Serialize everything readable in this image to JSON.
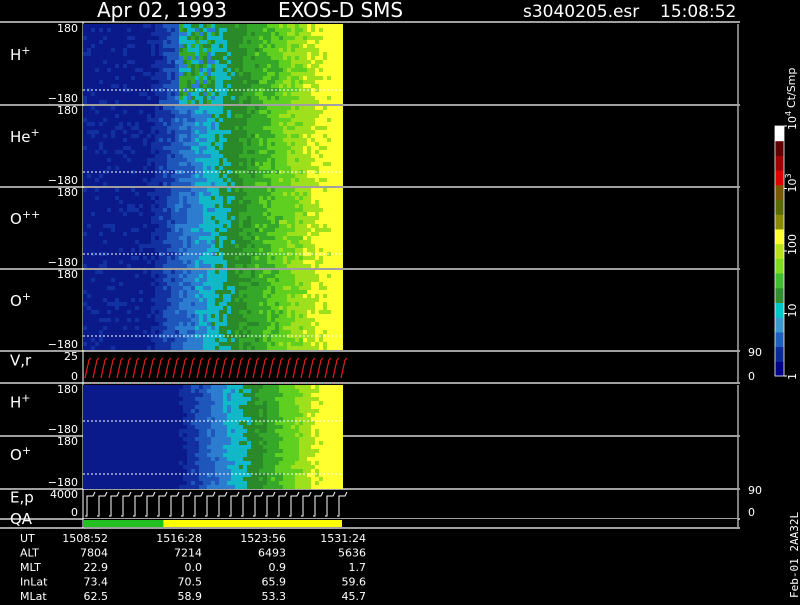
{
  "header": {
    "date": "Apr 02, 1993",
    "instrument": "EXOS-D SMS",
    "file": "s3040205.esr",
    "time": "15:08:52"
  },
  "colorbar": {
    "unit": "Ct/Smp",
    "ticks": [
      {
        "label": "1",
        "value": 1
      },
      {
        "label": "10",
        "value": 10
      },
      {
        "label": "100",
        "value": 100
      },
      {
        "label": "10",
        "sup": "3",
        "value": 1000
      },
      {
        "label": "10",
        "sup": "4",
        "value": 10000
      }
    ],
    "colors": [
      "#00008b",
      "#0a2a9c",
      "#1f5fbf",
      "#3a9ad0",
      "#00c8c8",
      "#2f8f2f",
      "#3fbf2f",
      "#7fdc1f",
      "#b9e21a",
      "#ffff30",
      "#8a8a00",
      "#5a6b00",
      "#7a5a00",
      "#e00000",
      "#a00000",
      "#600000",
      "#ffffff"
    ]
  },
  "panels": [
    {
      "species": "H",
      "charge": "+",
      "ymax": "180",
      "ymin": "−180"
    },
    {
      "species": "He",
      "charge": "+",
      "ymax": "180",
      "ymin": "−180"
    },
    {
      "species": "O",
      "charge": "++",
      "ymax": "180",
      "ymin": "−180"
    },
    {
      "species": "O",
      "charge": "+",
      "ymax": "180",
      "ymin": "−180"
    },
    {
      "species": "V,r",
      "charge": "",
      "ymax": "25",
      "ymin": "0",
      "rmax": "90",
      "rmin": "0"
    },
    {
      "species": "H",
      "charge": "+",
      "ymax": "180",
      "ymin": "−180"
    },
    {
      "species": "O",
      "charge": "+",
      "ymax": "180",
      "ymin": "−180"
    },
    {
      "species": "E,p",
      "charge": "",
      "ymax": "4000",
      "ymin": "0",
      "rmax": "90",
      "rmin": "0"
    },
    {
      "species": "QA",
      "charge": "",
      "ymax": "",
      "ymin": ""
    }
  ],
  "table": {
    "labels": [
      "UT",
      "ALT",
      "MLT",
      "InLat",
      "MLat"
    ],
    "columns": [
      [
        "1508:52",
        "7804",
        "22.9",
        "73.4",
        "62.5"
      ],
      [
        "1516:28",
        "7214",
        "0.0",
        "70.5",
        "58.9"
      ],
      [
        "1523:56",
        "6493",
        "0.9",
        "65.9",
        "53.3"
      ],
      [
        "1531:24",
        "5636",
        "1.7",
        "59.6",
        "45.7"
      ]
    ]
  },
  "side_label": "Feb-01 2AA32L",
  "chart_data": {
    "type": "heatmap",
    "title": "Apr 02, 1993   EXOS-D SMS",
    "x_ticks_ut": [
      "1508:52",
      "1516:28",
      "1523:56",
      "1531:24"
    ],
    "panels": [
      "H+",
      "He+",
      "O++",
      "O+",
      "V,r",
      "H+",
      "O+",
      "E,p",
      "QA"
    ],
    "colorbar_unit": "Ct/Smp",
    "colorbar_scale": "log",
    "colorbar_range": [
      1,
      10000
    ],
    "data_end_fraction": 0.4,
    "quality_segments": [
      {
        "from": "1508:52",
        "to": "1516:28",
        "color": "#22c022"
      },
      {
        "from": "1516:28",
        "to": "1531:24",
        "color": "#ffff00"
      }
    ]
  }
}
